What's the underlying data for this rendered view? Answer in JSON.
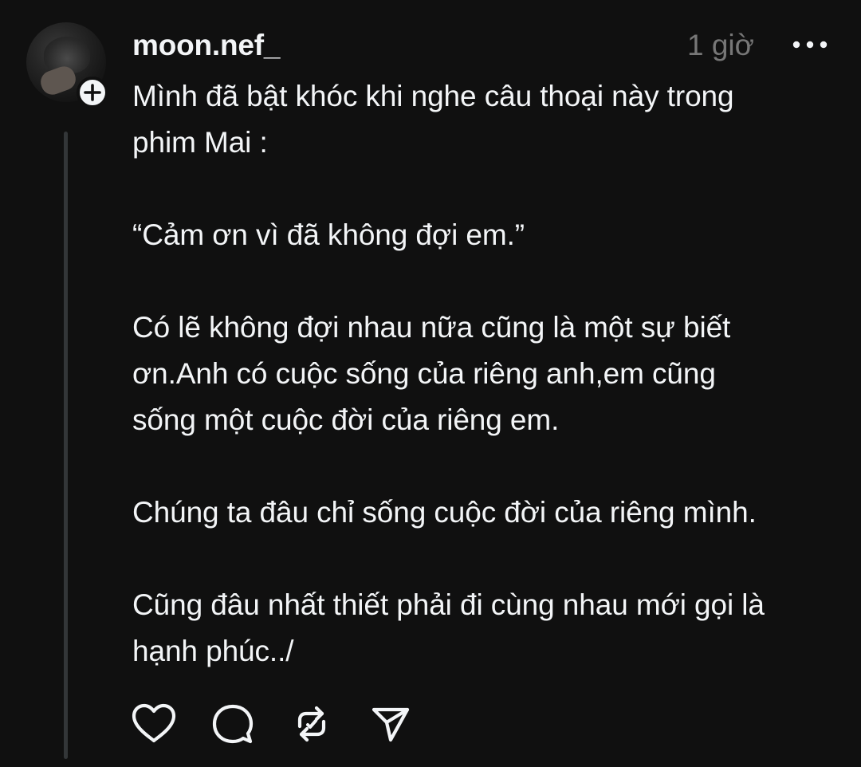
{
  "post": {
    "username": "moon.nef_",
    "timestamp": "1 giờ",
    "more_icon": "more-horizontal-icon",
    "follow_icon": "plus-icon",
    "text": {
      "l1": "Mình đã bật khóc khi nghe câu thoại này trong",
      "l2": "phim Mai :",
      "l3": "“Cảm ơn vì đã không đợi em.”",
      "l4": "Có lẽ không đợi nhau nữa cũng là một sự biết",
      "l5": "ơn.Anh có cuộc sống của riêng anh,em cũng",
      "l6": "sống một cuộc đời của riêng em.",
      "l7": "Chúng ta đâu chỉ sống cuộc đời của riêng mình.",
      "l8": "Cũng đâu nhất thiết phải đi cùng nhau mới gọi là",
      "l9": "hạnh phúc../"
    },
    "actions": [
      "heart-icon",
      "comment-icon",
      "repost-icon",
      "share-icon"
    ]
  },
  "colors": {
    "background": "#101010",
    "text": "#f3f5f7",
    "muted": "#777777",
    "thread_line": "#333638"
  }
}
